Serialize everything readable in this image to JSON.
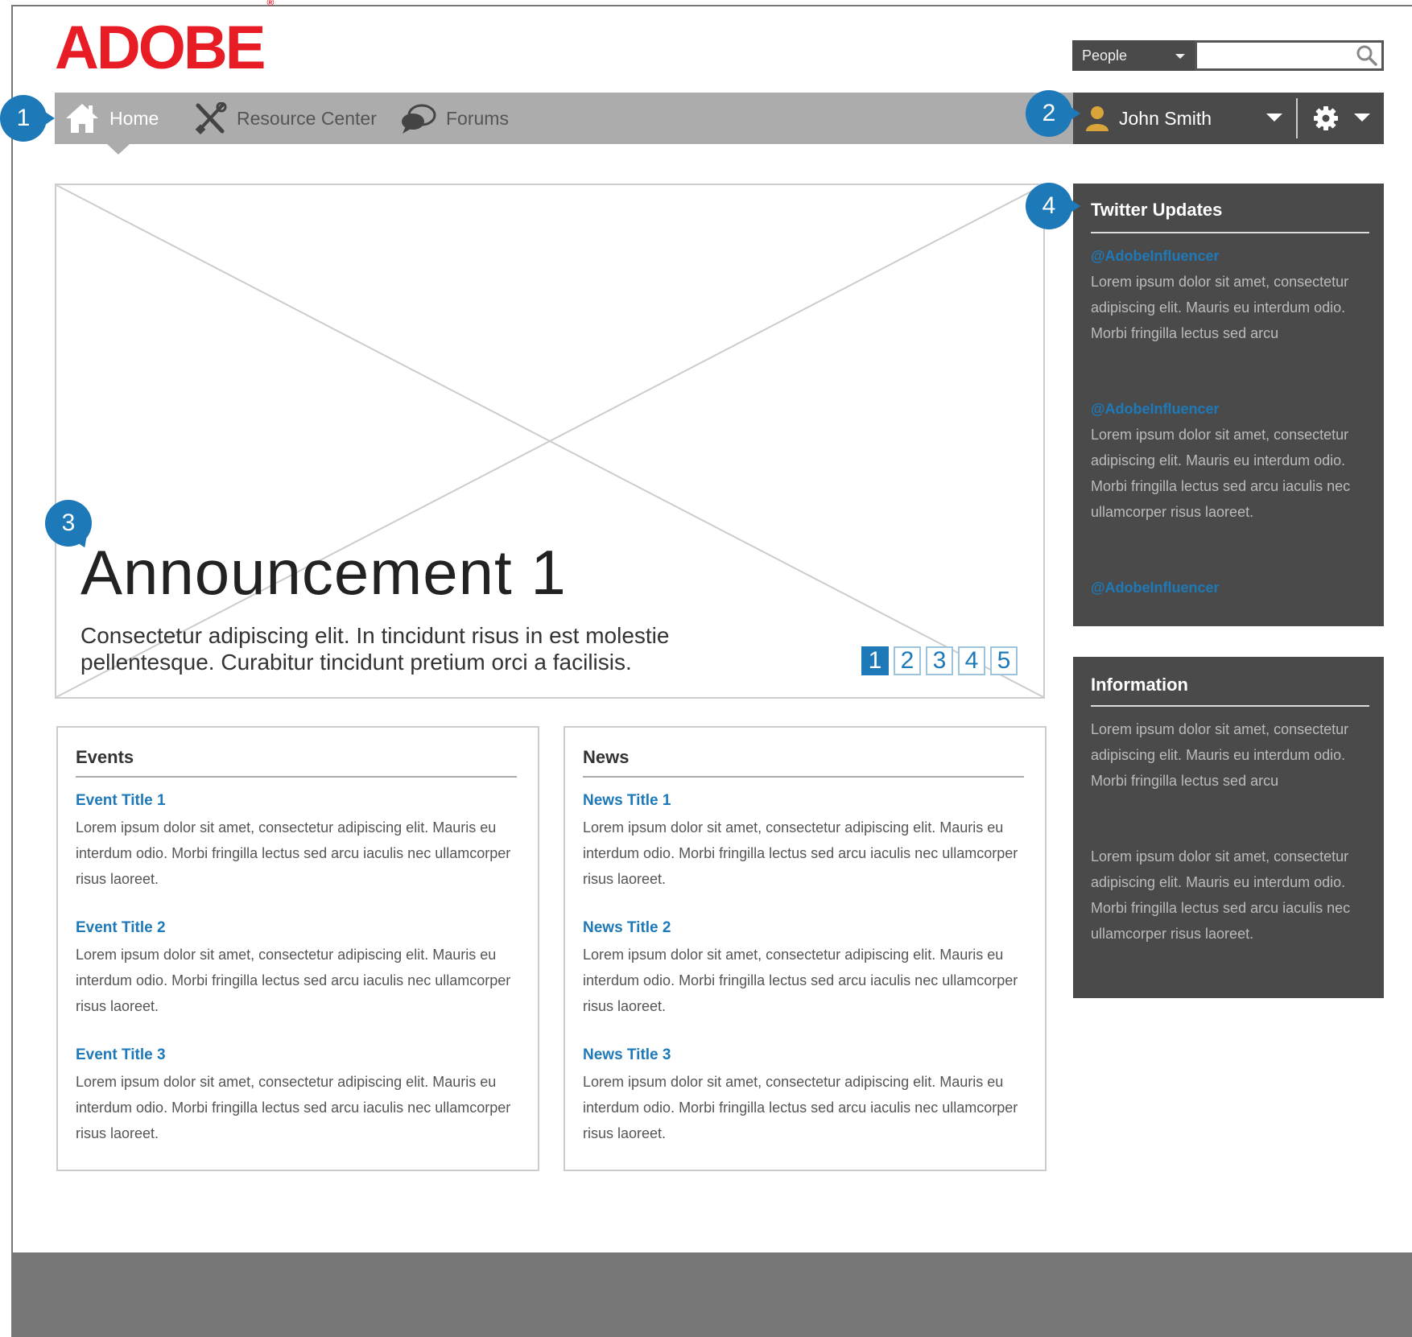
{
  "logo": {
    "text": "ADOBE",
    "mark": "®",
    "color": "#e81c24"
  },
  "search": {
    "scope": "People",
    "placeholder": "",
    "value": "",
    "icon": "search-icon"
  },
  "nav": {
    "items": [
      {
        "label": "Home",
        "icon": "home-icon",
        "active": true
      },
      {
        "label": "Resource Center",
        "icon": "tools-icon",
        "active": false
      },
      {
        "label": "Forums",
        "icon": "chat-bubbles-icon",
        "active": false
      }
    ]
  },
  "user": {
    "name": "John Smith",
    "icon": "user-icon",
    "settings_icon": "gear-icon"
  },
  "markers": {
    "m1": "1",
    "m2": "2",
    "m3": "3",
    "m4": "4"
  },
  "hero": {
    "title": "Announcement 1",
    "text": "Consectetur adipiscing elit. In tincidunt risus in est molestie pellentesque. Curabitur tincidunt pretium orci a facilisis.",
    "pages": [
      "1",
      "2",
      "3",
      "4",
      "5"
    ],
    "active_page": "1"
  },
  "events": {
    "title": "Events",
    "items": [
      {
        "title": "Event Title 1",
        "body": "Lorem ipsum dolor sit amet, consectetur adipiscing elit. Mauris eu interdum odio. Morbi fringilla lectus sed arcu iaculis nec ullamcorper risus laoreet."
      },
      {
        "title": "Event Title 2",
        "body": "Lorem ipsum dolor sit amet, consectetur adipiscing elit. Mauris eu interdum odio. Morbi fringilla lectus sed arcu iaculis nec ullamcorper risus laoreet."
      },
      {
        "title": "Event Title 3",
        "body": "Lorem ipsum dolor sit amet, consectetur adipiscing elit. Mauris eu interdum odio. Morbi fringilla lectus sed arcu iaculis nec ullamcorper risus laoreet."
      }
    ]
  },
  "news": {
    "title": "News",
    "items": [
      {
        "title": "News Title 1",
        "body": "Lorem ipsum dolor sit amet, consectetur adipiscing elit. Mauris eu interdum odio. Morbi fringilla lectus sed arcu iaculis nec ullamcorper risus laoreet."
      },
      {
        "title": "News Title 2",
        "body": "Lorem ipsum dolor sit amet, consectetur adipiscing elit. Mauris eu interdum odio. Morbi fringilla lectus sed arcu iaculis nec ullamcorper risus laoreet."
      },
      {
        "title": "News Title 3",
        "body": "Lorem ipsum dolor sit amet, consectetur adipiscing elit. Mauris eu interdum odio. Morbi fringilla lectus sed arcu iaculis nec ullamcorper risus laoreet."
      }
    ]
  },
  "twitter": {
    "title": "Twitter Updates",
    "tweets": [
      {
        "handle": "@AdobeInfluencer",
        "text": "Lorem ipsum dolor sit amet, consectetur adipiscing elit. Mauris eu interdum odio. Morbi fringilla lectus sed arcu"
      },
      {
        "handle": "@AdobeInfluencer",
        "text": "Lorem ipsum dolor sit amet, consectetur adipiscing elit. Mauris eu interdum odio. Morbi fringilla lectus sed arcu iaculis nec ullamcorper risus laoreet."
      },
      {
        "handle": "@AdobeInfluencer",
        "text": ""
      }
    ]
  },
  "information": {
    "title": "Information",
    "paragraphs": [
      "Lorem ipsum dolor sit amet, consectetur adipiscing elit. Mauris eu interdum odio. Morbi fringilla lectus sed arcu",
      "Lorem ipsum dolor sit amet, consectetur adipiscing elit. Mauris eu interdum odio. Morbi fringilla lectus sed arcu iaculis nec ullamcorper risus laoreet."
    ]
  },
  "colors": {
    "accent": "#1e79b8",
    "nav_bg": "#acacac",
    "dark_panel": "#4a4a4a",
    "footer": "#777777",
    "user_icon": "#d9a43a"
  }
}
